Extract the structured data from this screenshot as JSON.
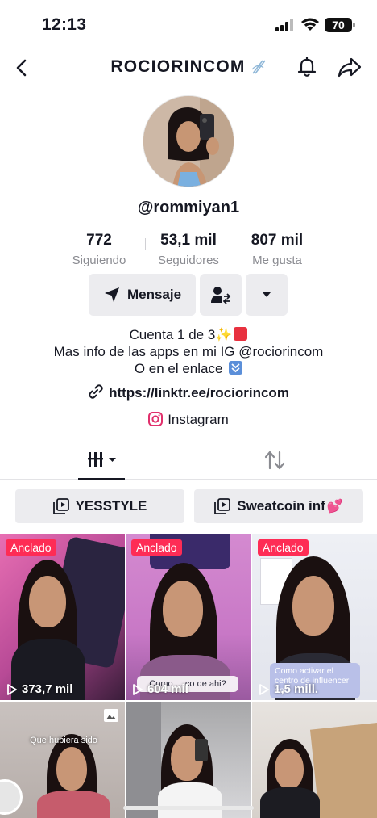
{
  "status_bar": {
    "time": "12:13",
    "battery": "70"
  },
  "nav": {
    "title": "ROCIORINCOM"
  },
  "profile": {
    "username": "@rommiyan1",
    "stats": [
      {
        "value": "772",
        "label": "Siguiendo"
      },
      {
        "value": "53,1 mil",
        "label": "Seguidores"
      },
      {
        "value": "807 mil",
        "label": "Me gusta"
      }
    ],
    "message_button": "Mensaje",
    "bio": {
      "line1": "Cuenta 1 de 3",
      "line2": "Mas info de las apps en mi IG @rociorincom",
      "line3": "O en el enlace"
    },
    "link": "https://linktr.ee/rociorincom",
    "instagram": "Instagram"
  },
  "playlists": [
    {
      "label": "YESSTYLE"
    },
    {
      "label": "Sweatcoin inf"
    }
  ],
  "videos": [
    {
      "pinned": "Anclado",
      "views": "373,7 mil"
    },
    {
      "pinned": "Anclado",
      "views": "604 mil",
      "caption": "Como ... co de ahi?"
    },
    {
      "pinned": "Anclado",
      "views": "1,5 mill.",
      "caption": "Como activar el centro de influencer en"
    },
    {
      "caption": "Que hubiera sido"
    },
    {},
    {}
  ],
  "colors": {
    "accent": "#fe2c55",
    "button_bg": "#ececef",
    "muted_text": "#8a8b91"
  }
}
